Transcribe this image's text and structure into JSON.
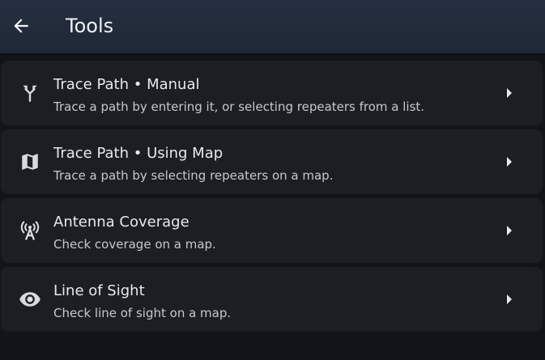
{
  "header": {
    "title": "Tools",
    "back_icon": "arrow-left-icon"
  },
  "tools": [
    {
      "title": "Trace Path • Manual",
      "subtitle": "Trace a path by entering it, or selecting repeaters from a list.",
      "icon": "fork-route-icon"
    },
    {
      "title": "Trace Path • Using Map",
      "subtitle": "Trace a path by selecting repeaters on a map.",
      "icon": "map-icon"
    },
    {
      "title": "Antenna Coverage",
      "subtitle": "Check coverage on a map.",
      "icon": "antenna-icon"
    },
    {
      "title": "Line of Sight",
      "subtitle": "Check line of sight on a map.",
      "icon": "eye-icon"
    }
  ],
  "colors": {
    "app_bar": "#222b3a",
    "background": "#111418",
    "card": "#1b1e23",
    "text_primary": "#e7e9ed",
    "text_secondary": "#c5c9cf"
  }
}
